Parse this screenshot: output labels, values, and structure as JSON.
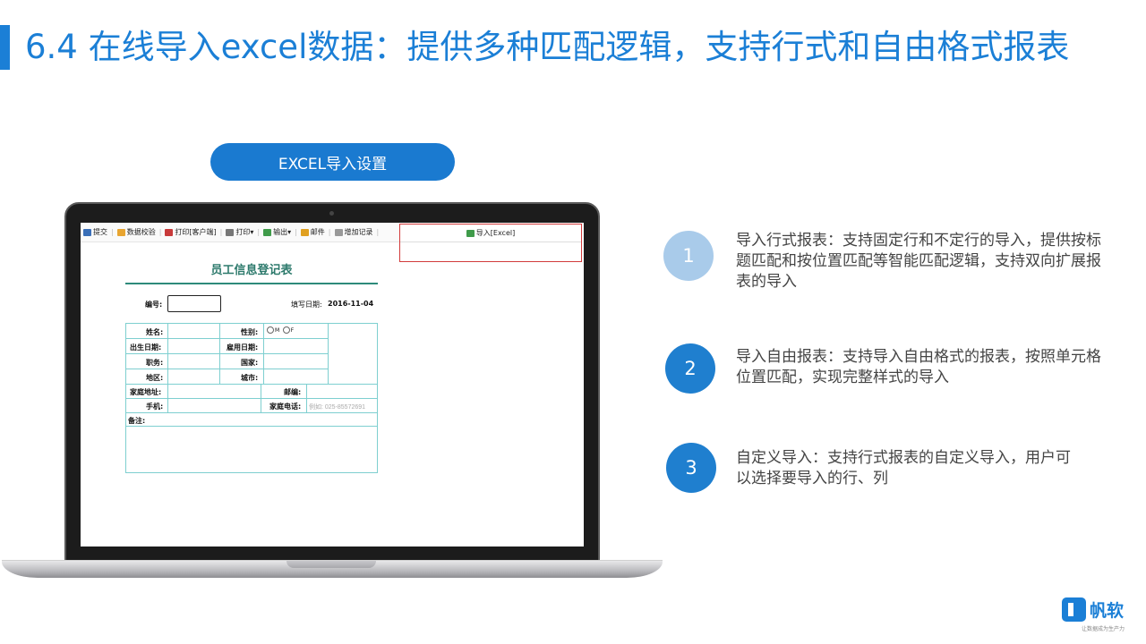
{
  "title": "6.4 在线导入excel数据：提供多种匹配逻辑，支持行式和自由格式报表",
  "pill_label": "EXCEL导入设置",
  "toolbar": {
    "items": [
      "提交",
      "数据校验",
      "打印[客户端]",
      "打印",
      "输出",
      "邮件",
      "增加记录"
    ],
    "import_label": "导入[Excel]"
  },
  "form": {
    "title": "员工信息登记表",
    "number_label": "编号:",
    "date_label": "填写日期:",
    "date_value": "2016-11-04",
    "fields": {
      "name": "姓名:",
      "gender": "性别:",
      "gender_m": "M",
      "gender_f": "F",
      "birth": "出生日期:",
      "hire": "雇用日期:",
      "position": "职务:",
      "country": "国家:",
      "region": "地区:",
      "city": "城市:",
      "address": "家庭地址:",
      "postcode": "邮编:",
      "mobile": "手机:",
      "home_phone": "家庭电话:",
      "home_phone_placeholder": "例如: 025-85572691",
      "remark": "备注:"
    }
  },
  "features": [
    {
      "number": "1",
      "text": "导入行式报表：支持固定行和不定行的导入，提供按标题匹配和按位置匹配等智能匹配逻辑，支持双向扩展报表的导入"
    },
    {
      "number": "2",
      "text": "导入自由报表：支持导入自由格式的报表，按照单元格位置匹配，实现完整样式的导入"
    },
    {
      "number": "3",
      "text": "自定义导入：支持行式报表的自定义导入，用户可以选择要导入的行、列"
    }
  ],
  "logo": {
    "name": "帆软",
    "tagline": "让数据成为生产力"
  },
  "colors": {
    "accent": "#1b7fd6",
    "circle_light": "#a9cbea",
    "circle_dark": "#1f7fcf"
  }
}
